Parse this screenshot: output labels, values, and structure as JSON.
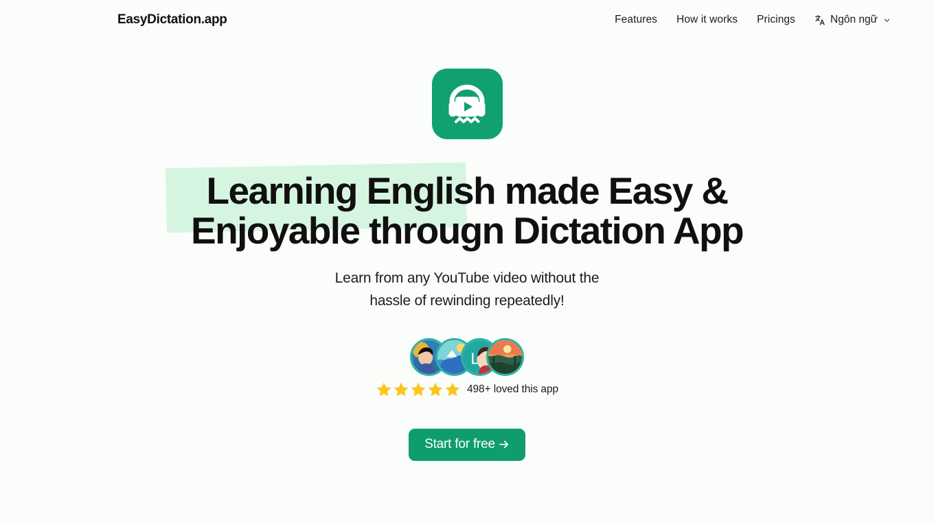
{
  "header": {
    "brand": "EasyDictation.app",
    "nav": [
      {
        "label": "Features"
      },
      {
        "label": "How it works"
      },
      {
        "label": "Pricings"
      }
    ],
    "language": {
      "label": "Ngôn ngữ",
      "icon": "translate-icon",
      "chevron": "chevron-down-icon"
    }
  },
  "hero": {
    "logo_icon": "headphones-play-logo",
    "headline": {
      "line1_highlight": "Learning English",
      "line1_rest": " made Easy &",
      "line2": "Enjoyable througn Dictation App"
    },
    "subtitle_line1": "Learn from any YouTube video without the",
    "subtitle_line2": "hassle of rewinding repeatedly!",
    "social_proof": {
      "avatar_count": 4,
      "star_count": 5,
      "rating_text": "498+ loved this app"
    },
    "cta": {
      "label": "Start for free",
      "arrow_icon": "arrow-right-icon"
    }
  },
  "colors": {
    "page_background": "#fafdf9",
    "brand_green": "#0f9d6f",
    "logo_green": "#11a071",
    "highlight_mint": "#d6f5e1",
    "star_gold": "#fbc51b",
    "avatar_ring": "#2bb3a3",
    "text_dark": "#101010"
  }
}
